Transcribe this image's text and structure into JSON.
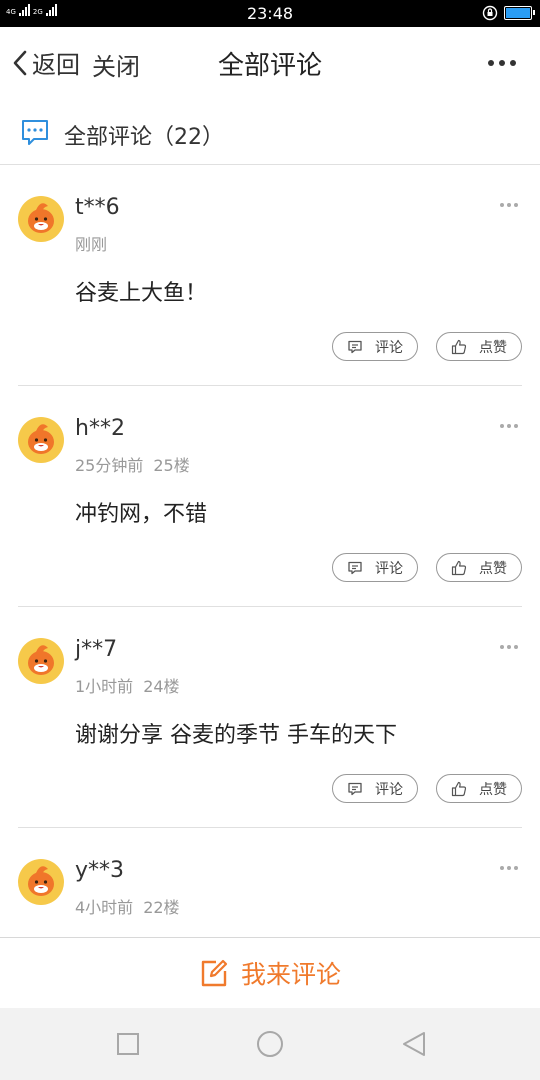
{
  "status_bar": {
    "network_1": "4G",
    "network_2": "2G",
    "time": "23:48",
    "battery_level": 1.0,
    "battery_color": "#2a9df4"
  },
  "navbar": {
    "back_label": "返回",
    "close_label": "关闭",
    "title": "全部评论",
    "more_icon": "more-horizontal-icon"
  },
  "section": {
    "title": "全部评论（22）",
    "icon": "comment-bubble-icon"
  },
  "comments": [
    {
      "user": "t**6",
      "time": "刚刚",
      "floor": "",
      "content": "谷麦上大鱼！"
    },
    {
      "user": "h**2",
      "time": "25分钟前",
      "floor": "25楼",
      "content": "冲钓网，不错"
    },
    {
      "user": "j**7",
      "time": "1小时前",
      "floor": "24楼",
      "content": "谢谢分享 谷麦的季节 手车的天下"
    },
    {
      "user": "y**3",
      "time": "4小时前",
      "floor": "22楼",
      "content": ""
    }
  ],
  "actions": {
    "comment_label": "评论",
    "like_label": "点赞"
  },
  "bottom_bar": {
    "label": "我来评论",
    "accent_color": "#f07a2c"
  },
  "system_nav": {
    "recents": "square-icon",
    "home": "circle-icon",
    "back": "triangle-back-icon"
  }
}
